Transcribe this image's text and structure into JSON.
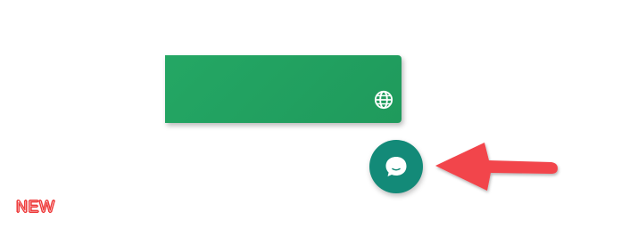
{
  "banner": {
    "color": "#22a161",
    "globe_icon": "globe-icon"
  },
  "chat": {
    "icon": "chat-bubble-icon",
    "color": "#138a78"
  },
  "annotation": {
    "arrow_color": "#f2444b",
    "badge_text": "NEW",
    "badge_color": "#ee3b3b"
  }
}
